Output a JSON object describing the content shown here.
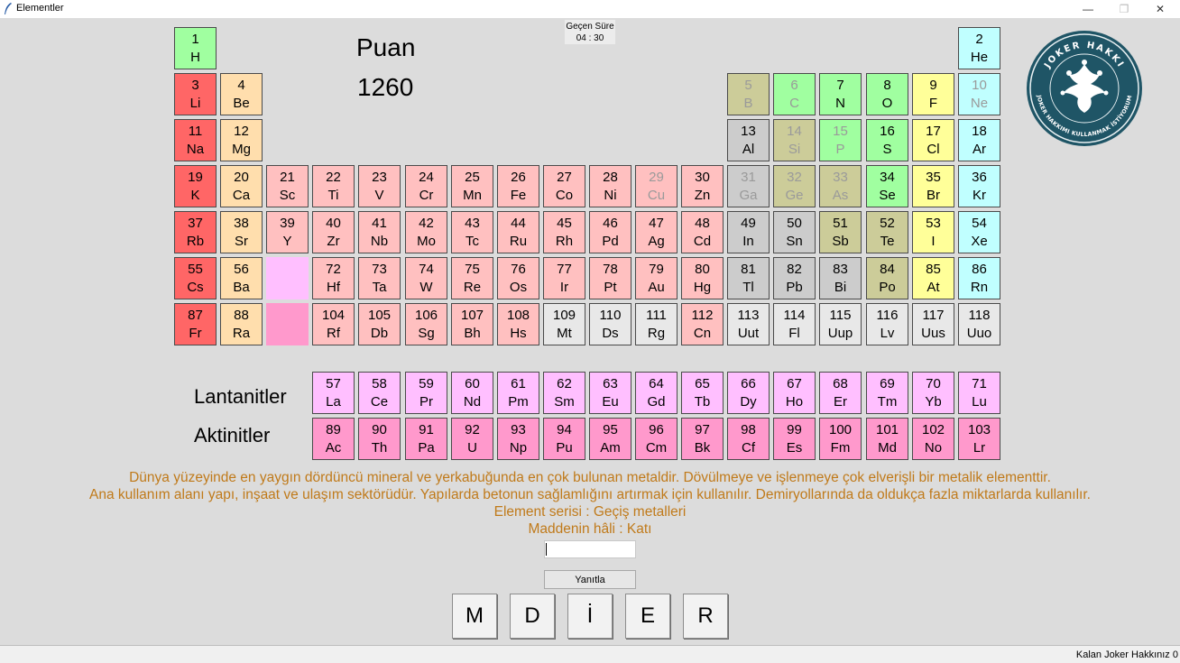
{
  "window": {
    "title": "Elementler",
    "min_glyph": "—",
    "max_glyph": "❐",
    "close_glyph": "✕"
  },
  "score": {
    "label": "Puan",
    "value": "1260"
  },
  "timer": {
    "label": "Geçen Süre",
    "value": "04 : 30"
  },
  "series_labels": {
    "lanthanides": "Lantanitler",
    "actinides": "Aktinitler"
  },
  "colors": {
    "alkali": "#ff6666",
    "alkaline_earth": "#ffdead",
    "transition": "#ffc0c0",
    "post_transition": "#cccccc",
    "metalloid": "#cccc99",
    "nonmetal": "#a0ffa0",
    "halogen": "#ffff99",
    "noble_gas": "#c0ffff",
    "lanthanide": "#ffbfff",
    "actinide": "#ff99cc",
    "unknown": "#e8e8e8",
    "hint_text": "#c07a1a"
  },
  "elements": [
    {
      "n": "1",
      "s": "H",
      "c": "nonmetal",
      "r": 0,
      "g": 0
    },
    {
      "n": "2",
      "s": "He",
      "c": "noble_gas",
      "r": 0,
      "g": 17
    },
    {
      "n": "3",
      "s": "Li",
      "c": "alkali",
      "r": 1,
      "g": 0
    },
    {
      "n": "4",
      "s": "Be",
      "c": "alkaline_earth",
      "r": 1,
      "g": 1
    },
    {
      "n": "5",
      "s": "B",
      "c": "metalloid",
      "r": 1,
      "g": 12,
      "f": true
    },
    {
      "n": "6",
      "s": "C",
      "c": "nonmetal",
      "r": 1,
      "g": 13,
      "f": true
    },
    {
      "n": "7",
      "s": "N",
      "c": "nonmetal",
      "r": 1,
      "g": 14
    },
    {
      "n": "8",
      "s": "O",
      "c": "nonmetal",
      "r": 1,
      "g": 15
    },
    {
      "n": "9",
      "s": "F",
      "c": "halogen",
      "r": 1,
      "g": 16
    },
    {
      "n": "10",
      "s": "Ne",
      "c": "noble_gas",
      "r": 1,
      "g": 17,
      "f": true
    },
    {
      "n": "11",
      "s": "Na",
      "c": "alkali",
      "r": 2,
      "g": 0
    },
    {
      "n": "12",
      "s": "Mg",
      "c": "alkaline_earth",
      "r": 2,
      "g": 1
    },
    {
      "n": "13",
      "s": "Al",
      "c": "post_transition",
      "r": 2,
      "g": 12
    },
    {
      "n": "14",
      "s": "Si",
      "c": "metalloid",
      "r": 2,
      "g": 13,
      "f": true
    },
    {
      "n": "15",
      "s": "P",
      "c": "nonmetal",
      "r": 2,
      "g": 14,
      "f": true
    },
    {
      "n": "16",
      "s": "S",
      "c": "nonmetal",
      "r": 2,
      "g": 15
    },
    {
      "n": "17",
      "s": "Cl",
      "c": "halogen",
      "r": 2,
      "g": 16
    },
    {
      "n": "18",
      "s": "Ar",
      "c": "noble_gas",
      "r": 2,
      "g": 17
    },
    {
      "n": "19",
      "s": "K",
      "c": "alkali",
      "r": 3,
      "g": 0
    },
    {
      "n": "20",
      "s": "Ca",
      "c": "alkaline_earth",
      "r": 3,
      "g": 1
    },
    {
      "n": "21",
      "s": "Sc",
      "c": "transition",
      "r": 3,
      "g": 2
    },
    {
      "n": "22",
      "s": "Ti",
      "c": "transition",
      "r": 3,
      "g": 3
    },
    {
      "n": "23",
      "s": "V",
      "c": "transition",
      "r": 3,
      "g": 4
    },
    {
      "n": "24",
      "s": "Cr",
      "c": "transition",
      "r": 3,
      "g": 5
    },
    {
      "n": "25",
      "s": "Mn",
      "c": "transition",
      "r": 3,
      "g": 6
    },
    {
      "n": "26",
      "s": "Fe",
      "c": "transition",
      "r": 3,
      "g": 7
    },
    {
      "n": "27",
      "s": "Co",
      "c": "transition",
      "r": 3,
      "g": 8
    },
    {
      "n": "28",
      "s": "Ni",
      "c": "transition",
      "r": 3,
      "g": 9
    },
    {
      "n": "29",
      "s": "Cu",
      "c": "transition",
      "r": 3,
      "g": 10,
      "f": true
    },
    {
      "n": "30",
      "s": "Zn",
      "c": "transition",
      "r": 3,
      "g": 11
    },
    {
      "n": "31",
      "s": "Ga",
      "c": "post_transition",
      "r": 3,
      "g": 12,
      "f": true
    },
    {
      "n": "32",
      "s": "Ge",
      "c": "metalloid",
      "r": 3,
      "g": 13,
      "f": true
    },
    {
      "n": "33",
      "s": "As",
      "c": "metalloid",
      "r": 3,
      "g": 14,
      "f": true
    },
    {
      "n": "34",
      "s": "Se",
      "c": "nonmetal",
      "r": 3,
      "g": 15
    },
    {
      "n": "35",
      "s": "Br",
      "c": "halogen",
      "r": 3,
      "g": 16
    },
    {
      "n": "36",
      "s": "Kr",
      "c": "noble_gas",
      "r": 3,
      "g": 17
    },
    {
      "n": "37",
      "s": "Rb",
      "c": "alkali",
      "r": 4,
      "g": 0
    },
    {
      "n": "38",
      "s": "Sr",
      "c": "alkaline_earth",
      "r": 4,
      "g": 1
    },
    {
      "n": "39",
      "s": "Y",
      "c": "transition",
      "r": 4,
      "g": 2
    },
    {
      "n": "40",
      "s": "Zr",
      "c": "transition",
      "r": 4,
      "g": 3
    },
    {
      "n": "41",
      "s": "Nb",
      "c": "transition",
      "r": 4,
      "g": 4
    },
    {
      "n": "42",
      "s": "Mo",
      "c": "transition",
      "r": 4,
      "g": 5
    },
    {
      "n": "43",
      "s": "Tc",
      "c": "transition",
      "r": 4,
      "g": 6
    },
    {
      "n": "44",
      "s": "Ru",
      "c": "transition",
      "r": 4,
      "g": 7
    },
    {
      "n": "45",
      "s": "Rh",
      "c": "transition",
      "r": 4,
      "g": 8
    },
    {
      "n": "46",
      "s": "Pd",
      "c": "transition",
      "r": 4,
      "g": 9
    },
    {
      "n": "47",
      "s": "Ag",
      "c": "transition",
      "r": 4,
      "g": 10
    },
    {
      "n": "48",
      "s": "Cd",
      "c": "transition",
      "r": 4,
      "g": 11
    },
    {
      "n": "49",
      "s": "In",
      "c": "post_transition",
      "r": 4,
      "g": 12
    },
    {
      "n": "50",
      "s": "Sn",
      "c": "post_transition",
      "r": 4,
      "g": 13
    },
    {
      "n": "51",
      "s": "Sb",
      "c": "metalloid",
      "r": 4,
      "g": 14
    },
    {
      "n": "52",
      "s": "Te",
      "c": "metalloid",
      "r": 4,
      "g": 15
    },
    {
      "n": "53",
      "s": "I",
      "c": "halogen",
      "r": 4,
      "g": 16
    },
    {
      "n": "54",
      "s": "Xe",
      "c": "noble_gas",
      "r": 4,
      "g": 17
    },
    {
      "n": "55",
      "s": "Cs",
      "c": "alkali",
      "r": 5,
      "g": 0
    },
    {
      "n": "56",
      "s": "Ba",
      "c": "alkaline_earth",
      "r": 5,
      "g": 1
    },
    {
      "n": "",
      "s": "",
      "c": "lanthanide",
      "r": 5,
      "g": 2,
      "placeholder": true
    },
    {
      "n": "72",
      "s": "Hf",
      "c": "transition",
      "r": 5,
      "g": 3
    },
    {
      "n": "73",
      "s": "Ta",
      "c": "transition",
      "r": 5,
      "g": 4
    },
    {
      "n": "74",
      "s": "W",
      "c": "transition",
      "r": 5,
      "g": 5
    },
    {
      "n": "75",
      "s": "Re",
      "c": "transition",
      "r": 5,
      "g": 6
    },
    {
      "n": "76",
      "s": "Os",
      "c": "transition",
      "r": 5,
      "g": 7
    },
    {
      "n": "77",
      "s": "Ir",
      "c": "transition",
      "r": 5,
      "g": 8
    },
    {
      "n": "78",
      "s": "Pt",
      "c": "transition",
      "r": 5,
      "g": 9
    },
    {
      "n": "79",
      "s": "Au",
      "c": "transition",
      "r": 5,
      "g": 10
    },
    {
      "n": "80",
      "s": "Hg",
      "c": "transition",
      "r": 5,
      "g": 11
    },
    {
      "n": "81",
      "s": "Tl",
      "c": "post_transition",
      "r": 5,
      "g": 12
    },
    {
      "n": "82",
      "s": "Pb",
      "c": "post_transition",
      "r": 5,
      "g": 13
    },
    {
      "n": "83",
      "s": "Bi",
      "c": "post_transition",
      "r": 5,
      "g": 14
    },
    {
      "n": "84",
      "s": "Po",
      "c": "metalloid",
      "r": 5,
      "g": 15
    },
    {
      "n": "85",
      "s": "At",
      "c": "halogen",
      "r": 5,
      "g": 16
    },
    {
      "n": "86",
      "s": "Rn",
      "c": "noble_gas",
      "r": 5,
      "g": 17
    },
    {
      "n": "87",
      "s": "Fr",
      "c": "alkali",
      "r": 6,
      "g": 0
    },
    {
      "n": "88",
      "s": "Ra",
      "c": "alkaline_earth",
      "r": 6,
      "g": 1
    },
    {
      "n": "",
      "s": "",
      "c": "actinide",
      "r": 6,
      "g": 2,
      "placeholder": true
    },
    {
      "n": "104",
      "s": "Rf",
      "c": "transition",
      "r": 6,
      "g": 3
    },
    {
      "n": "105",
      "s": "Db",
      "c": "transition",
      "r": 6,
      "g": 4
    },
    {
      "n": "106",
      "s": "Sg",
      "c": "transition",
      "r": 6,
      "g": 5
    },
    {
      "n": "107",
      "s": "Bh",
      "c": "transition",
      "r": 6,
      "g": 6
    },
    {
      "n": "108",
      "s": "Hs",
      "c": "transition",
      "r": 6,
      "g": 7
    },
    {
      "n": "109",
      "s": "Mt",
      "c": "unknown",
      "r": 6,
      "g": 8
    },
    {
      "n": "110",
      "s": "Ds",
      "c": "unknown",
      "r": 6,
      "g": 9
    },
    {
      "n": "111",
      "s": "Rg",
      "c": "unknown",
      "r": 6,
      "g": 10
    },
    {
      "n": "112",
      "s": "Cn",
      "c": "transition",
      "r": 6,
      "g": 11
    },
    {
      "n": "113",
      "s": "Uut",
      "c": "unknown",
      "r": 6,
      "g": 12
    },
    {
      "n": "114",
      "s": "Fl",
      "c": "unknown",
      "r": 6,
      "g": 13
    },
    {
      "n": "115",
      "s": "Uup",
      "c": "unknown",
      "r": 6,
      "g": 14
    },
    {
      "n": "116",
      "s": "Lv",
      "c": "unknown",
      "r": 6,
      "g": 15
    },
    {
      "n": "117",
      "s": "Uus",
      "c": "unknown",
      "r": 6,
      "g": 16
    },
    {
      "n": "118",
      "s": "Uuo",
      "c": "unknown",
      "r": 6,
      "g": 17
    },
    {
      "n": "57",
      "s": "La",
      "c": "lanthanide",
      "r": 7,
      "g": 3
    },
    {
      "n": "58",
      "s": "Ce",
      "c": "lanthanide",
      "r": 7,
      "g": 4
    },
    {
      "n": "59",
      "s": "Pr",
      "c": "lanthanide",
      "r": 7,
      "g": 5
    },
    {
      "n": "60",
      "s": "Nd",
      "c": "lanthanide",
      "r": 7,
      "g": 6
    },
    {
      "n": "61",
      "s": "Pm",
      "c": "lanthanide",
      "r": 7,
      "g": 7
    },
    {
      "n": "62",
      "s": "Sm",
      "c": "lanthanide",
      "r": 7,
      "g": 8
    },
    {
      "n": "63",
      "s": "Eu",
      "c": "lanthanide",
      "r": 7,
      "g": 9
    },
    {
      "n": "64",
      "s": "Gd",
      "c": "lanthanide",
      "r": 7,
      "g": 10
    },
    {
      "n": "65",
      "s": "Tb",
      "c": "lanthanide",
      "r": 7,
      "g": 11
    },
    {
      "n": "66",
      "s": "Dy",
      "c": "lanthanide",
      "r": 7,
      "g": 12
    },
    {
      "n": "67",
      "s": "Ho",
      "c": "lanthanide",
      "r": 7,
      "g": 13
    },
    {
      "n": "68",
      "s": "Er",
      "c": "lanthanide",
      "r": 7,
      "g": 14
    },
    {
      "n": "69",
      "s": "Tm",
      "c": "lanthanide",
      "r": 7,
      "g": 15
    },
    {
      "n": "70",
      "s": "Yb",
      "c": "lanthanide",
      "r": 7,
      "g": 16
    },
    {
      "n": "71",
      "s": "Lu",
      "c": "lanthanide",
      "r": 7,
      "g": 17
    },
    {
      "n": "89",
      "s": "Ac",
      "c": "actinide",
      "r": 8,
      "g": 3
    },
    {
      "n": "90",
      "s": "Th",
      "c": "actinide",
      "r": 8,
      "g": 4
    },
    {
      "n": "91",
      "s": "Pa",
      "c": "actinide",
      "r": 8,
      "g": 5
    },
    {
      "n": "92",
      "s": "U",
      "c": "actinide",
      "r": 8,
      "g": 6
    },
    {
      "n": "93",
      "s": "Np",
      "c": "actinide",
      "r": 8,
      "g": 7
    },
    {
      "n": "94",
      "s": "Pu",
      "c": "actinide",
      "r": 8,
      "g": 8
    },
    {
      "n": "95",
      "s": "Am",
      "c": "actinide",
      "r": 8,
      "g": 9
    },
    {
      "n": "96",
      "s": "Cm",
      "c": "actinide",
      "r": 8,
      "g": 10
    },
    {
      "n": "97",
      "s": "Bk",
      "c": "actinide",
      "r": 8,
      "g": 11
    },
    {
      "n": "98",
      "s": "Cf",
      "c": "actinide",
      "r": 8,
      "g": 12
    },
    {
      "n": "99",
      "s": "Es",
      "c": "actinide",
      "r": 8,
      "g": 13
    },
    {
      "n": "100",
      "s": "Fm",
      "c": "actinide",
      "r": 8,
      "g": 14
    },
    {
      "n": "101",
      "s": "Md",
      "c": "actinide",
      "r": 8,
      "g": 15
    },
    {
      "n": "102",
      "s": "No",
      "c": "actinide",
      "r": 8,
      "g": 16
    },
    {
      "n": "103",
      "s": "Lr",
      "c": "actinide",
      "r": 8,
      "g": 17
    }
  ],
  "hints": {
    "line1": "Dünya yüzeyinde en yaygın dördüncü mineral ve yerkabuğunda en çok bulunan metaldir. Dövülmeye ve işlenmeye çok elverişli bir metalik elementtir.",
    "line2": "Ana kullanım alanı yapı, inşaat ve ulaşım sektörüdür. Yapılarda betonun sağlamlığını artırmak için kullanılır. Demiryollarında da oldukça fazla miktarlarda kullanılır.",
    "series": "Element serisi : Geçiş metalleri",
    "state": "Maddenin hâli : Katı"
  },
  "answer": {
    "value": "",
    "button_label": "Yanıtla"
  },
  "letters": [
    "M",
    "D",
    "İ",
    "E",
    "R"
  ],
  "status": {
    "joker_remaining": "Kalan Joker Hakkınız 0"
  },
  "logo": {
    "top_text": "JOKER HAKKI",
    "ring_text": "JOKER HAKKIMI KULLANMAK İSTİYORUM",
    "icon": "jester-hat-icon"
  }
}
